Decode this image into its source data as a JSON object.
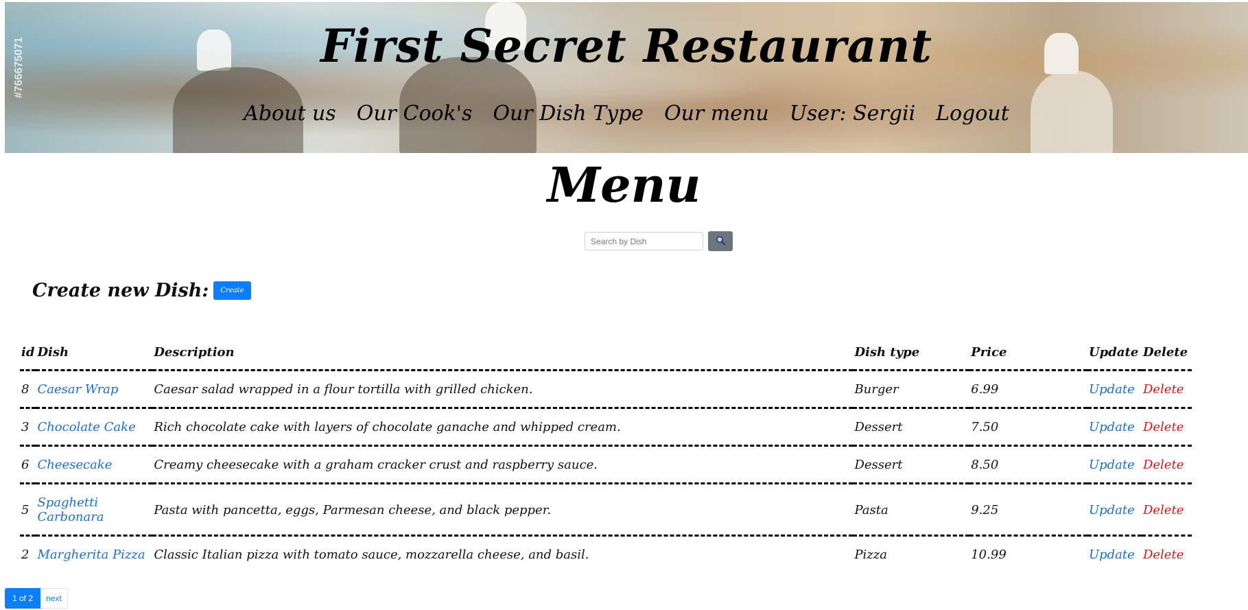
{
  "header": {
    "title": "First Secret Restaurant",
    "watermark": "#766675071",
    "nav": [
      "About us",
      "Our Cook's",
      "Our Dish Type",
      "Our menu",
      "User: Sergii",
      "Logout"
    ]
  },
  "page": {
    "heading": "Menu"
  },
  "search": {
    "placeholder": "Search by Dish",
    "button_icon": "search-icon"
  },
  "create": {
    "label": "Create new Dish:",
    "button": "Create"
  },
  "table": {
    "headers": [
      "id",
      "Dish",
      "Description",
      "Dish type",
      "Price",
      "Update",
      "Delete"
    ],
    "rows": [
      {
        "id": "8",
        "dish": "Caesar Wrap",
        "description": "Caesar salad wrapped in a flour tortilla with grilled chicken.",
        "type": "Burger",
        "price": "6.99",
        "update": "Update",
        "delete": "Delete"
      },
      {
        "id": "3",
        "dish": "Chocolate Cake",
        "description": "Rich chocolate cake with layers of chocolate ganache and whipped cream.",
        "type": "Dessert",
        "price": "7.50",
        "update": "Update",
        "delete": "Delete"
      },
      {
        "id": "6",
        "dish": "Cheesecake",
        "description": "Creamy cheesecake with a graham cracker crust and raspberry sauce.",
        "type": "Dessert",
        "price": "8.50",
        "update": "Update",
        "delete": "Delete"
      },
      {
        "id": "5",
        "dish": "Spaghetti Carbonara",
        "description": "Pasta with pancetta, eggs, Parmesan cheese, and black pepper.",
        "type": "Pasta",
        "price": "9.25",
        "update": "Update",
        "delete": "Delete"
      },
      {
        "id": "2",
        "dish": "Margherita Pizza",
        "description": "Classic Italian pizza with tomato sauce, mozzarella cheese, and basil.",
        "type": "Pizza",
        "price": "10.99",
        "update": "Update",
        "delete": "Delete"
      }
    ]
  },
  "pagination": {
    "current": "1 of 2",
    "next": "next"
  },
  "colors": {
    "primary": "#0d7ef8",
    "link": "#1a6fd1",
    "danger": "#d11a1a",
    "search_button": "#6c757d"
  }
}
